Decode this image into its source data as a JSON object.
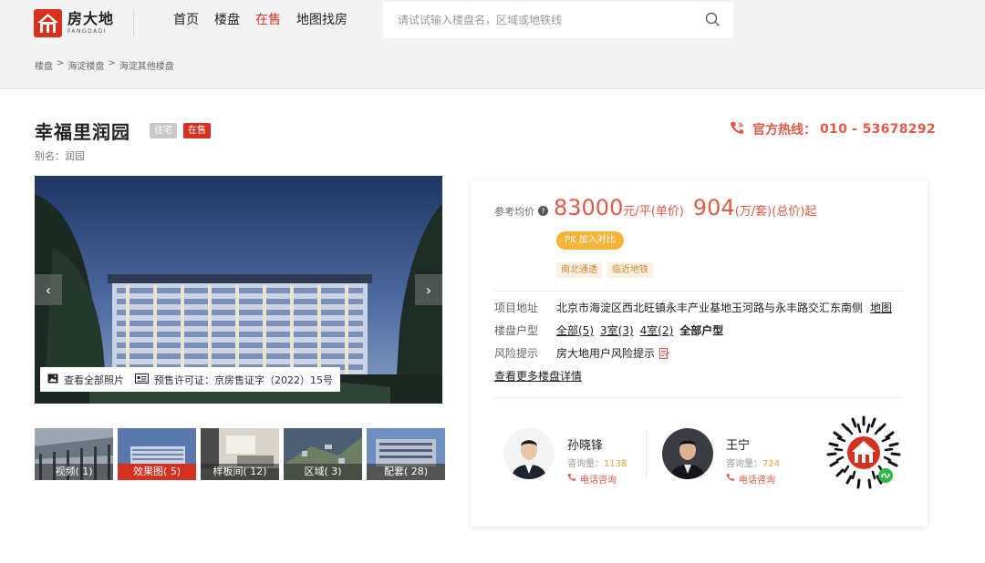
{
  "header": {
    "logo": {
      "cn": "房大地",
      "en": "FANGDADI"
    },
    "nav": [
      {
        "label": "首页",
        "active": false
      },
      {
        "label": "楼盘",
        "active": false
      },
      {
        "label": "在售",
        "active": true
      },
      {
        "label": "地图找房",
        "active": false
      }
    ],
    "search": {
      "placeholder": "请试试输入楼盘名，区域或地铁线",
      "value": ""
    }
  },
  "breadcrumb": [
    "楼盘",
    "海淀楼盘",
    "海淀其他楼盘"
  ],
  "project": {
    "name": "幸福里润园",
    "tags": [
      "住宅",
      "在售"
    ],
    "alias": "别名：润园",
    "hotline_label": "官方热线：",
    "hotline_number": "010 - 53678292"
  },
  "gallery": {
    "photos_button": "查看全部照片",
    "permit_button": "预售许可证：京房售证字（2022）15号",
    "prev": "‹",
    "next": "›",
    "thumbnails": [
      {
        "label": "视频( 1)",
        "active": false
      },
      {
        "label": "效果图( 5)",
        "active": true
      },
      {
        "label": "样板间( 12)",
        "active": false
      },
      {
        "label": "区域( 3)",
        "active": false
      },
      {
        "label": "配套( 28)",
        "active": false
      }
    ]
  },
  "price": {
    "label": "参考均价",
    "unit_price": "83000",
    "unit_price_suffix": "元/平(单价)",
    "total_price": "904",
    "total_price_suffix": "(万/套)(总价)起",
    "compare_button": "PK 加入对比",
    "features": [
      "南北通透",
      "临近地铁"
    ]
  },
  "details": {
    "address_key": "项目地址",
    "address": "北京市海淀区西北旺镇永丰产业基地玉河路与永丰路交汇东南侧",
    "map_link": "地图",
    "units_key": "楼盘户型",
    "units": [
      "全部(5)",
      "3室(3)",
      "4室(2)"
    ],
    "units_all": "全部户型",
    "risk_key": "风险提示",
    "risk": "房大地用户风险提示",
    "more_link": "查看更多楼盘详情"
  },
  "agents": [
    {
      "name": "孙晓锋",
      "count_label": "咨询量：",
      "count": "1138",
      "call": "电话咨询"
    },
    {
      "name": "王宁",
      "count_label": "咨询量：",
      "count": "724",
      "call": "电话咨询"
    }
  ],
  "colors": {
    "brand": "#d6301f",
    "price": "#e05a47",
    "accent": "#f6b43a"
  }
}
